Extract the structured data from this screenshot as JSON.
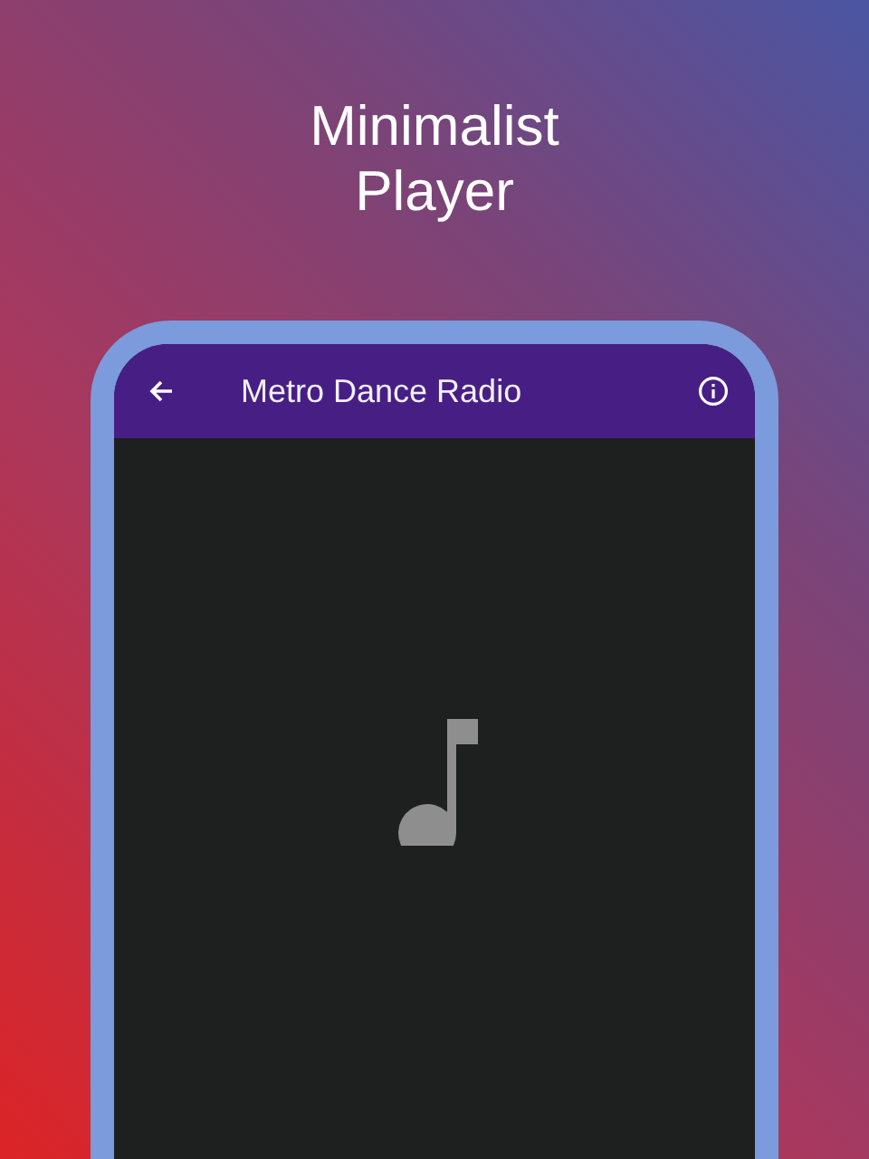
{
  "headline": "Minimalist Player",
  "app_bar": {
    "title": "Metro Dance Radio"
  }
}
